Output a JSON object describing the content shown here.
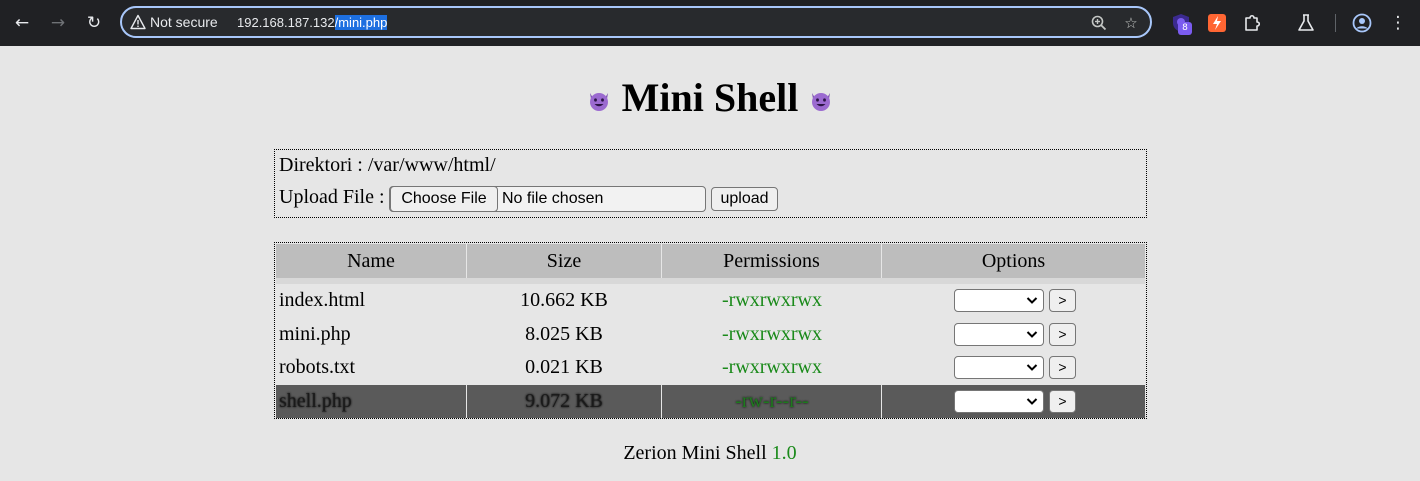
{
  "browser": {
    "security_label": "Not secure",
    "url_host": "192.168.187.132",
    "url_path": "/mini.php",
    "extension_badge": "8"
  },
  "page": {
    "title": "Mini Shell",
    "directory_line": "Direktori : /var/www/html/",
    "upload_label": "Upload File :",
    "choose_file_label": "Choose File",
    "no_file_label": "No file chosen",
    "upload_button": "upload",
    "table": {
      "headers": [
        "Name",
        "Size",
        "Permissions",
        "Options"
      ],
      "rows": [
        {
          "name": "index.html",
          "size": "10.662 KB",
          "perm": "-rwxrwxrwx",
          "go": ">"
        },
        {
          "name": "mini.php",
          "size": "8.025 KB",
          "perm": "-rwxrwxrwx",
          "go": ">"
        },
        {
          "name": "robots.txt",
          "size": "0.021 KB",
          "perm": "-rwxrwxrwx",
          "go": ">"
        },
        {
          "name": "shell.php",
          "size": "9.072 KB",
          "perm": "-rw-r--r--",
          "go": ">"
        }
      ],
      "highlighted_row": 3
    },
    "footer_text": "Zerion Mini Shell",
    "footer_version": "1.0"
  },
  "colors": {
    "accent_green": "#1a8a1a",
    "header_gray": "#bdbdbd",
    "highlight_row": "#5a5a5a",
    "url_selection": "#1d6fe0"
  }
}
